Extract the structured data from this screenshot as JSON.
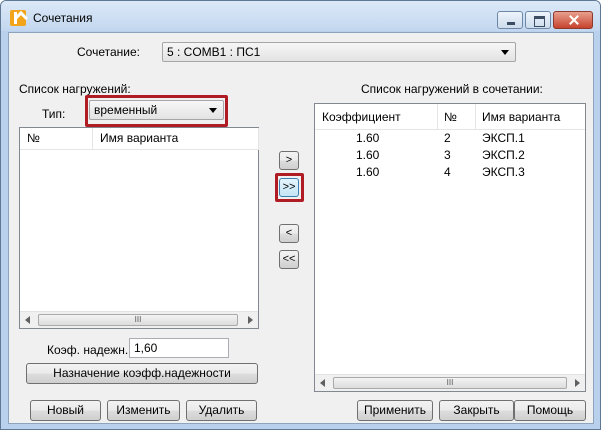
{
  "window": {
    "title": "Сочетания"
  },
  "combination": {
    "label": "Сочетание:",
    "value": "5 : COMB1 : ПС1"
  },
  "left_panel": {
    "title": "Список нагружений:",
    "type_label": "Тип:",
    "type_value": "временный",
    "columns": [
      "№",
      "Имя варианта"
    ],
    "rows": [],
    "scroll_grip": "III"
  },
  "transfer_buttons": {
    "add_one": ">",
    "add_all": ">>",
    "remove_one": "<",
    "remove_all": "<<"
  },
  "right_panel": {
    "title": "Список нагружений в сочетании:",
    "columns": [
      "Коэффициент",
      "№",
      "Имя варианта"
    ],
    "rows": [
      {
        "coef": "1.60",
        "num": "2",
        "name": "ЭКСП.1"
      },
      {
        "coef": "1.60",
        "num": "3",
        "name": "ЭКСП.2"
      },
      {
        "coef": "1.60",
        "num": "4",
        "name": "ЭКСП.3"
      }
    ],
    "scroll_grip": "III"
  },
  "reliability": {
    "label": "Коэф. надежн.:",
    "value": "1,60",
    "assign_button": "Назначение коэфф.надежности"
  },
  "footer_left": {
    "new": "Новый",
    "edit": "Изменить",
    "delete": "Удалить"
  },
  "footer_right": {
    "apply": "Применить",
    "close": "Закрыть",
    "help": "Помощь"
  },
  "colors": {
    "highlight": "#b01c24",
    "titlebar": "#c2d7ef"
  }
}
